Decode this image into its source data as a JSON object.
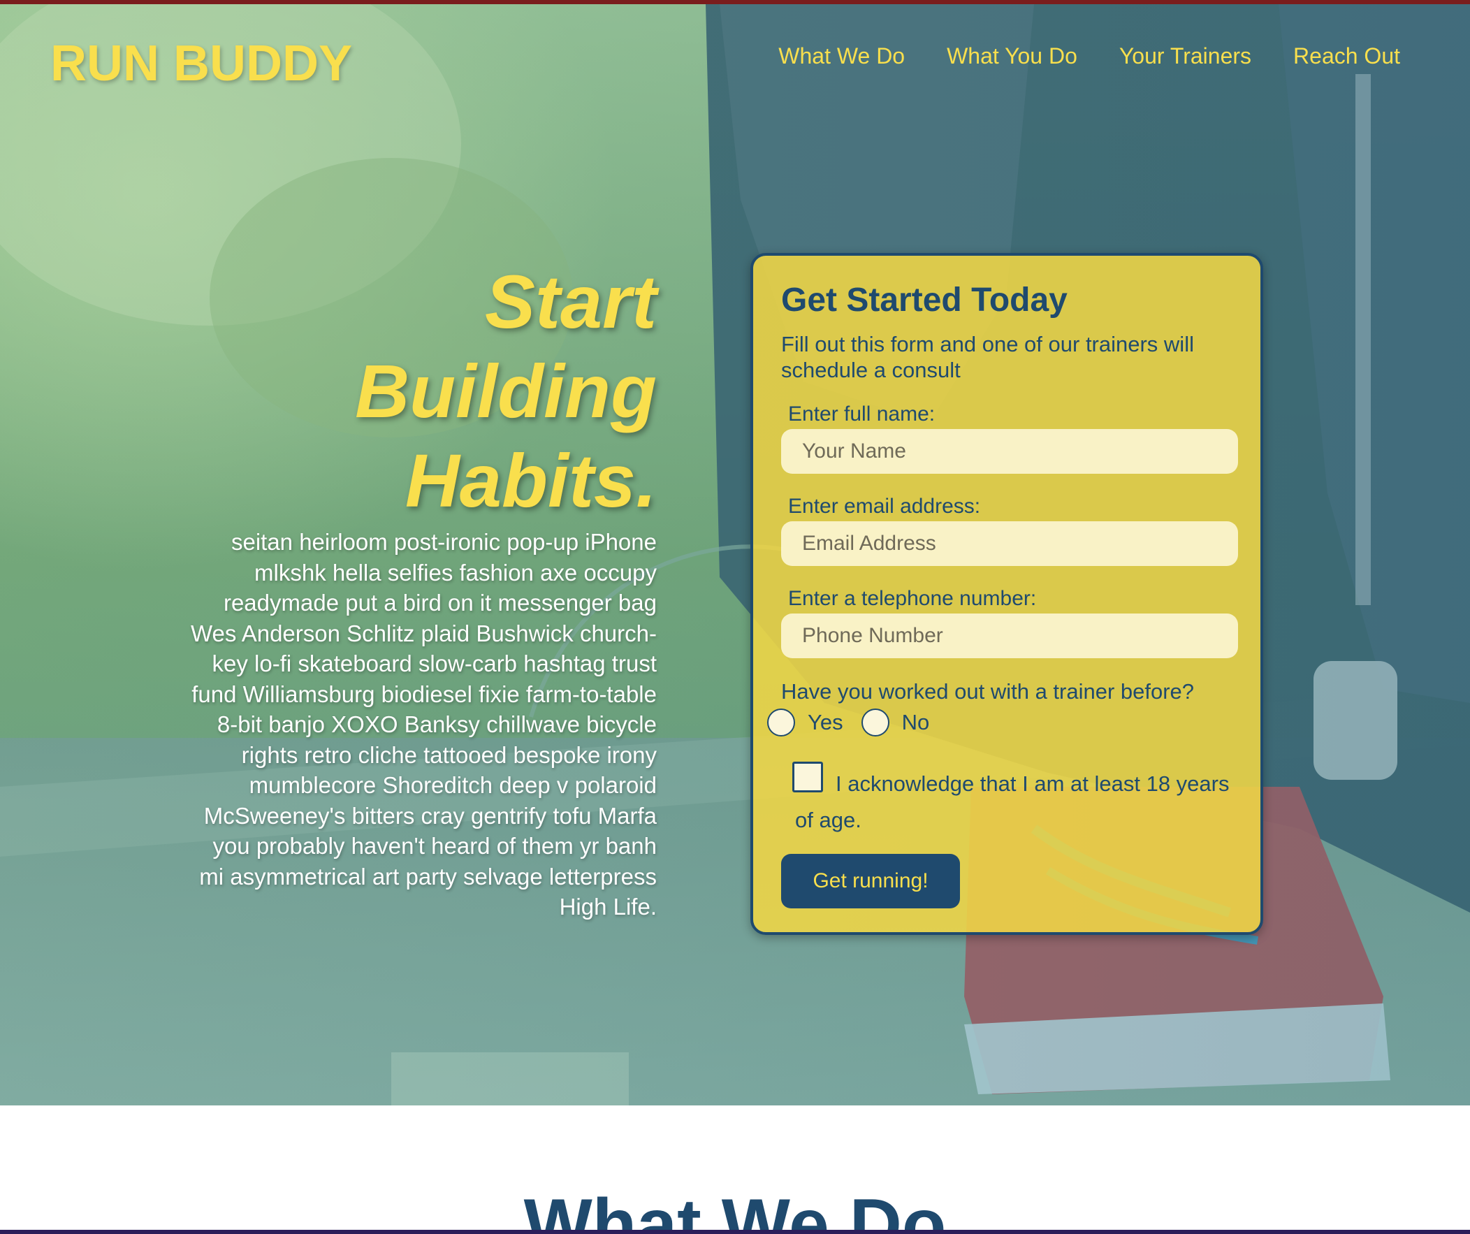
{
  "brand": {
    "logo": "RUN BUDDY"
  },
  "nav": {
    "items": [
      {
        "label": "What We Do"
      },
      {
        "label": "What You Do"
      },
      {
        "label": "Your Trainers"
      },
      {
        "label": "Reach Out"
      }
    ]
  },
  "hero": {
    "headline": "Start Building Habits.",
    "blurb": "seitan heirloom post-ironic pop-up iPhone mlkshk hella selfies fashion axe occupy readymade put a bird on it messenger bag Wes Anderson Schlitz plaid Bushwick church-key lo-fi skateboard slow-carb hashtag trust fund Williamsburg biodiesel fixie farm-to-table 8-bit banjo XOXO Banksy chillwave bicycle rights retro cliche tattooed bespoke irony mumblecore Shoreditch deep v polaroid McSweeney's bitters cray gentrify tofu Marfa you probably haven't heard of them yr banh mi asymmetrical art party selvage letterpress High Life."
  },
  "form": {
    "title": "Get Started Today",
    "subtitle": "Fill out this form and one of our trainers will schedule a consult",
    "name": {
      "label": "Enter full name:",
      "placeholder": "Your Name",
      "value": ""
    },
    "email": {
      "label": "Enter email address:",
      "placeholder": "Email Address",
      "value": ""
    },
    "phone": {
      "label": "Enter a telephone number:",
      "placeholder": "Phone Number",
      "value": ""
    },
    "question": "Have you worked out with a trainer before?",
    "options": [
      {
        "label": "Yes",
        "checked": false
      },
      {
        "label": "No",
        "checked": false
      }
    ],
    "acknowledge": {
      "label": "I acknowledge that I am at least 18 years of age.",
      "checked": false
    },
    "submit_label": "Get running!"
  },
  "next_section": {
    "title": "What We Do"
  },
  "colors": {
    "brand_yellow": "#f9df4d",
    "brand_navy": "#1f4a6e",
    "top_strip": "#7a1d1d"
  },
  "icons": {
    "hero_image": "runner-tying-shoe-photo"
  }
}
